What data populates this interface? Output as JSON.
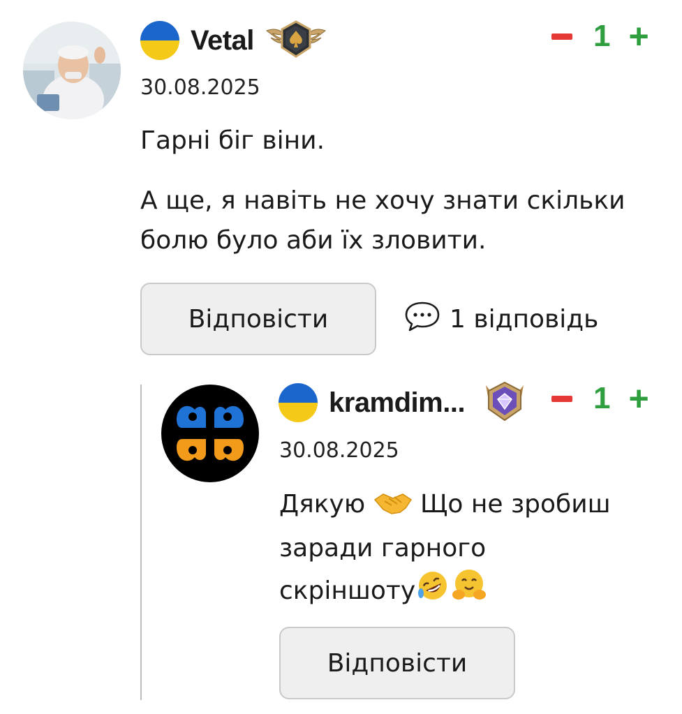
{
  "comment": {
    "username": "Vetal",
    "date": "30.08.2025",
    "votes": {
      "minus": "−",
      "count": "1",
      "plus": "+"
    },
    "paragraph_1": "Гарні біг віни.",
    "paragraph_2": "А ще, я навіть не хочу знати скільки болю було аби їх зловити.",
    "reply_label": "Відповісти",
    "replies_count_label": "1 відповідь",
    "flag_colors": {
      "top": "#1a66cc",
      "bottom": "#f5c918"
    },
    "badge_icon": "winged-spade-badge-icon"
  },
  "reply": {
    "username": "kramdim...",
    "date": "30.08.2025",
    "votes": {
      "minus": "−",
      "count": "1",
      "plus": "+"
    },
    "text_before_handshake": "Дякую",
    "text_after_handshake": "Що не зробиш зарадигарного",
    "text_line": "Що не зробиш зарадигарного",
    "line_1_rest": "Що не зробиш",
    "line_2": "заради гарного",
    "line_3": "скріншоту",
    "reply_label": "Відповісти",
    "badge_icon": "diamond-shield-badge-icon"
  },
  "colors": {
    "vote_minus": "#e53935",
    "vote_positive": "#2e9e3e",
    "button_bg": "#efefef",
    "button_border": "#c9c9c9"
  }
}
